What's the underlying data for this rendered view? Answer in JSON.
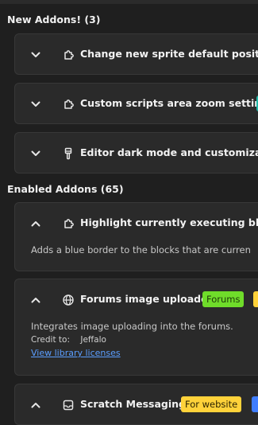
{
  "colors": {
    "background": "#1f1f1f",
    "card": "#2a2a2a",
    "teal_badge": "#1fb7a6",
    "green_badge": "#6fdc2a",
    "yellow_badge": "#ffd23a",
    "blue_badge": "#3f7dff",
    "link": "#5b9eff"
  },
  "new_addons": {
    "title": "New Addons! (3)",
    "items": [
      {
        "name": "Change new sprite default position",
        "icon": "puzzle-icon",
        "expanded": false
      },
      {
        "name": "Custom scripts area zoom settings",
        "icon": "puzzle-icon",
        "expanded": false
      },
      {
        "name": "Editor dark mode and customizable c",
        "icon": "paint-brush-icon",
        "expanded": false
      }
    ]
  },
  "enabled_addons": {
    "title": "Enabled Addons (65)",
    "items": [
      {
        "name": "Highlight currently executing blocks",
        "icon": "puzzle-icon",
        "expanded": true,
        "description": "Adds a blue border to the blocks that are curren"
      },
      {
        "name": "Forums image uploader",
        "icon": "globe-icon",
        "expanded": true,
        "badge": "Forums",
        "description": "Integrates image uploading into the forums.",
        "credit_label": "Credit to:",
        "credit_name": "Jeffalo",
        "link": "View library licenses"
      },
      {
        "name": "Scratch Messaging",
        "icon": "message-box-icon",
        "expanded": true,
        "badge": "For website"
      }
    ]
  }
}
